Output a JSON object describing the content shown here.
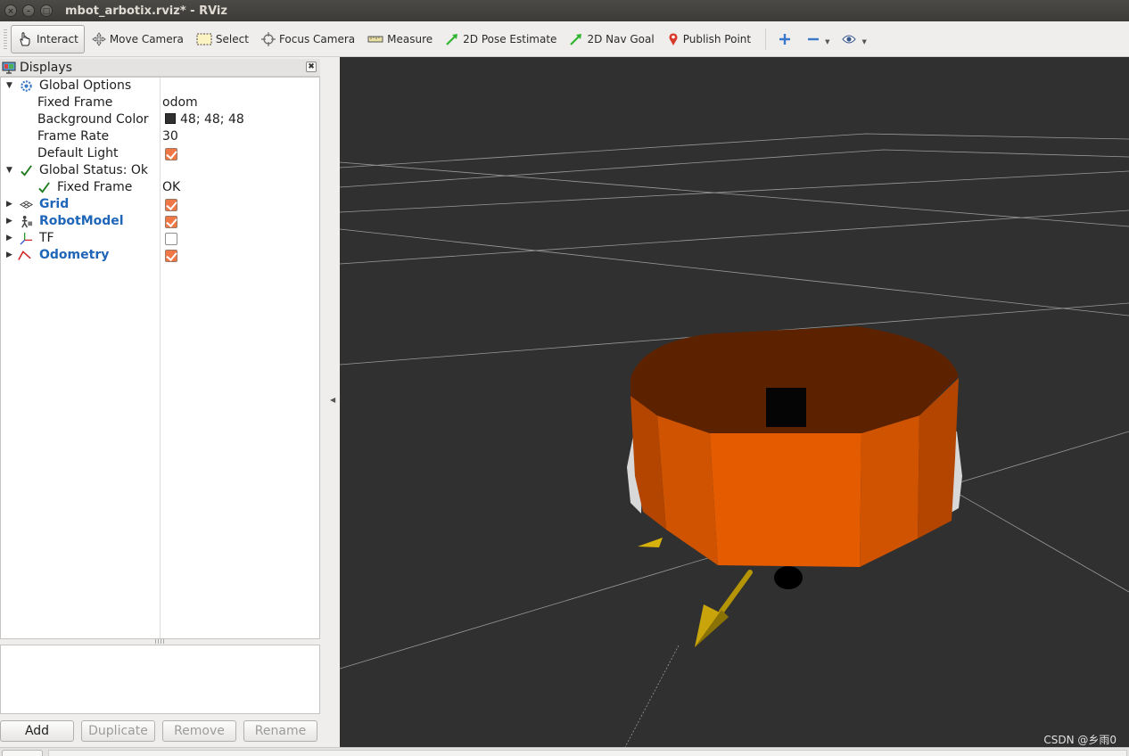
{
  "window": {
    "title": "mbot_arbotix.rviz* - RViz",
    "buttons": [
      "close",
      "minimize",
      "maximize"
    ]
  },
  "toolbar": {
    "tools": [
      {
        "label": "Interact",
        "icon": "hand-pointer-icon",
        "active": true
      },
      {
        "label": "Move Camera",
        "icon": "move-arrows-icon"
      },
      {
        "label": "Select",
        "icon": "select-rect-icon"
      },
      {
        "label": "Focus Camera",
        "icon": "crosshair-icon"
      },
      {
        "label": "Measure",
        "icon": "ruler-icon"
      },
      {
        "label": "2D Pose Estimate",
        "icon": "green-arrow-icon"
      },
      {
        "label": "2D Nav Goal",
        "icon": "green-arrow-icon"
      },
      {
        "label": "Publish Point",
        "icon": "map-pin-icon"
      }
    ],
    "extra_icons": [
      "plus-icon",
      "minus-icon",
      "eye-icon"
    ]
  },
  "displays": {
    "title": "Displays",
    "global_options": {
      "label": "Global Options",
      "fixed_frame": {
        "name": "Fixed Frame",
        "value": "odom"
      },
      "background_color": {
        "name": "Background Color",
        "value": "48; 48; 48",
        "color": "#303030"
      },
      "frame_rate": {
        "name": "Frame Rate",
        "value": "30"
      },
      "default_light": {
        "name": "Default Light",
        "checked": true
      }
    },
    "global_status": {
      "label": "Global Status: Ok",
      "fixed_frame": {
        "name": "Fixed Frame",
        "value": "OK"
      }
    },
    "items": [
      {
        "name": "Grid",
        "checked": true,
        "highlight": true
      },
      {
        "name": "RobotModel",
        "checked": true,
        "highlight": true
      },
      {
        "name": "TF",
        "checked": false,
        "highlight": false
      },
      {
        "name": "Odometry",
        "checked": true,
        "highlight": true
      }
    ],
    "buttons": {
      "add": "Add",
      "duplicate": "Duplicate",
      "remove": "Remove",
      "rename": "Rename"
    }
  },
  "view": {
    "background": "#303030",
    "watermark": "CSDN @乡雨0"
  },
  "colors": {
    "checkbox": "#f07746",
    "link_blue": "#1f66b9",
    "robot_orange": "#e55b00"
  }
}
